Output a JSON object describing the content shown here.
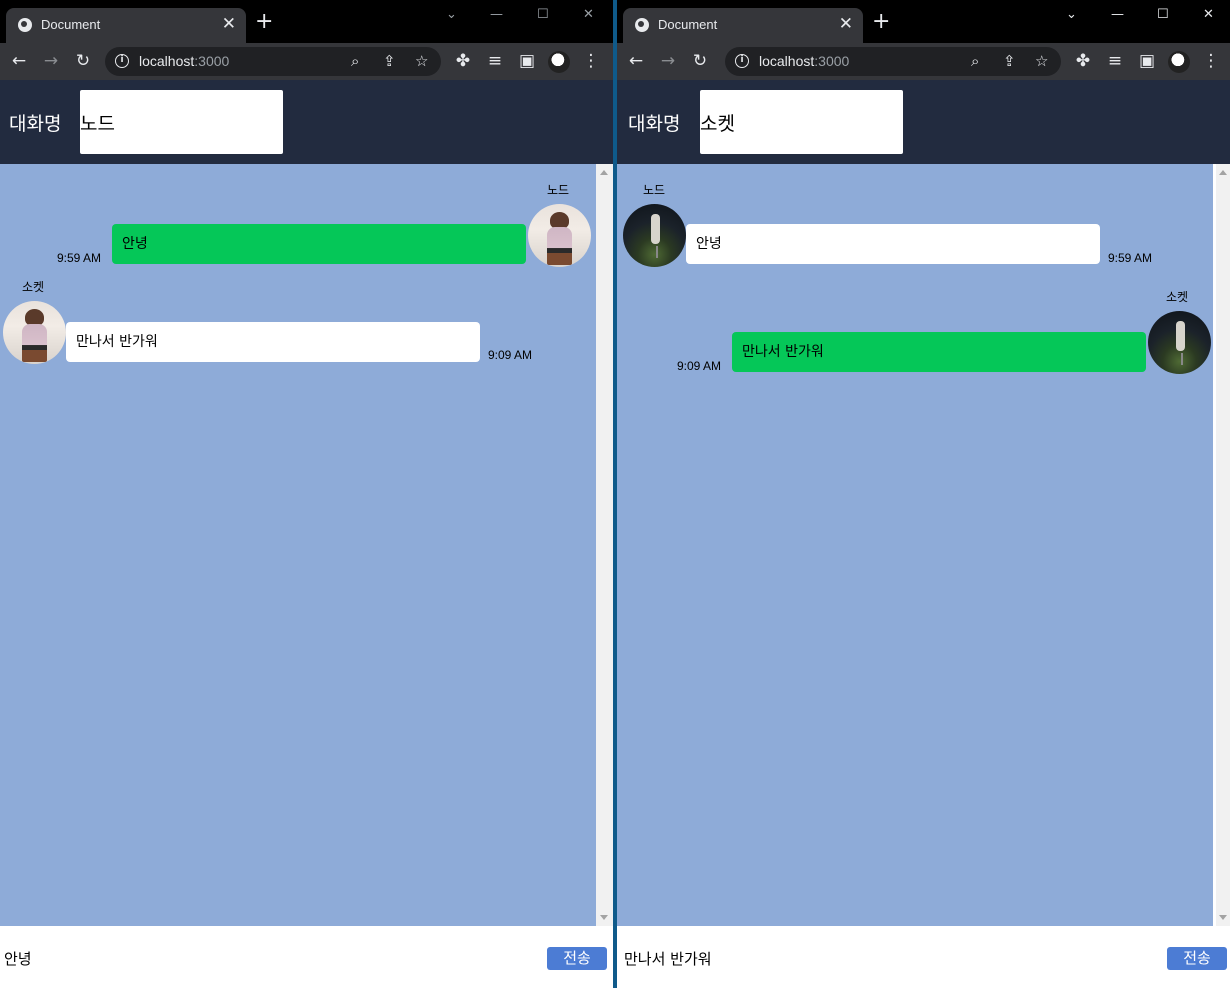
{
  "browser": {
    "tab_title": "Document",
    "tab_close": "✕",
    "new_tab": "+",
    "url_host": "localhost",
    "url_port": ":3000",
    "min_glyph": "—",
    "max_glyph": "☐",
    "close_glyph": "✕",
    "dropdown_glyph": "⌄"
  },
  "left": {
    "header_label": "대화명",
    "nickname_value": "노드",
    "messages": [
      {
        "sender": "노드",
        "text": "안녕",
        "time": "9:59 AM",
        "mine": true
      },
      {
        "sender": "소켓",
        "text": "만나서 반가워",
        "time": "9:09 AM",
        "mine": false
      }
    ],
    "compose_value": "안녕",
    "send_label": "전송"
  },
  "right": {
    "header_label": "대화명",
    "nickname_value": "소켓",
    "messages": [
      {
        "sender": "노드",
        "text": "안녕",
        "time": "9:59 AM",
        "mine": false
      },
      {
        "sender": "소켓",
        "text": "만나서 반가워",
        "time": "9:09 AM",
        "mine": true
      }
    ],
    "compose_value": "만나서 반가워",
    "send_label": "전송"
  },
  "colors": {
    "header_bg": "#222b3f",
    "chat_bg": "#8eabd8",
    "mine_bubble": "#05c758",
    "other_bubble": "#ffffff",
    "send_button": "#4c7cd4"
  },
  "icons": {
    "back": "back-arrow-icon",
    "forward": "forward-arrow-icon",
    "reload": "reload-icon",
    "info": "site-info-icon",
    "zoom": "zoom-icon",
    "share": "share-icon",
    "star": "bookmark-star-icon",
    "extensions": "extensions-puzzle-icon",
    "media": "media-queue-icon",
    "sidepanel": "side-panel-icon",
    "menu": "kebab-menu-icon"
  }
}
